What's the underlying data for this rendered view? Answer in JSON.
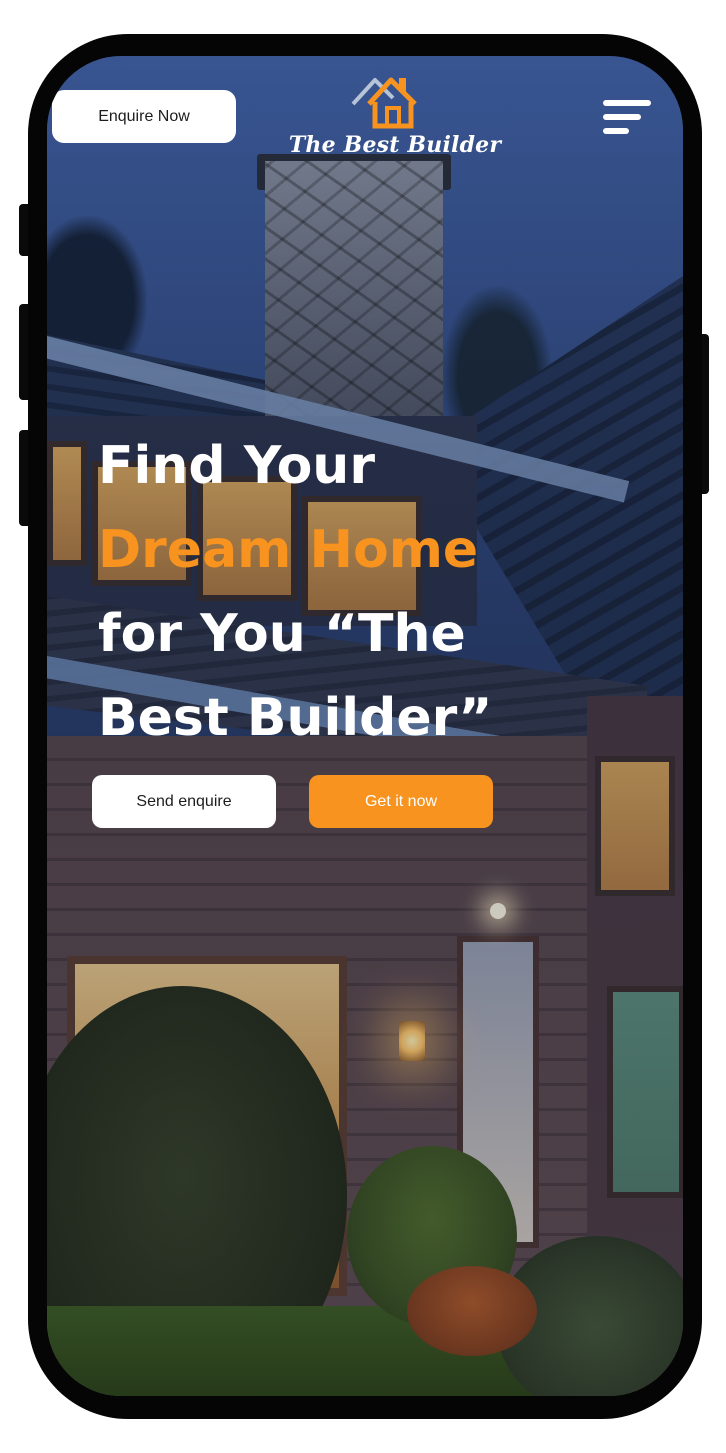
{
  "header": {
    "enquire_label": "Enquire Now",
    "brand_name": "The Best Builder",
    "logo_icon": "house-logo-icon",
    "menu_icon": "hamburger-menu-icon"
  },
  "hero": {
    "line1": "Find Your",
    "line2": "Dream Home",
    "line3": "for You “The",
    "line4": "Best Builder”",
    "accent_color": "#f7931e"
  },
  "actions": {
    "send_label": "Send enquire",
    "get_label": "Get it now"
  },
  "colors": {
    "primary_orange": "#f7931e",
    "button_white": "#ffffff",
    "text_white": "#ffffff",
    "device_frame": "#050505"
  }
}
